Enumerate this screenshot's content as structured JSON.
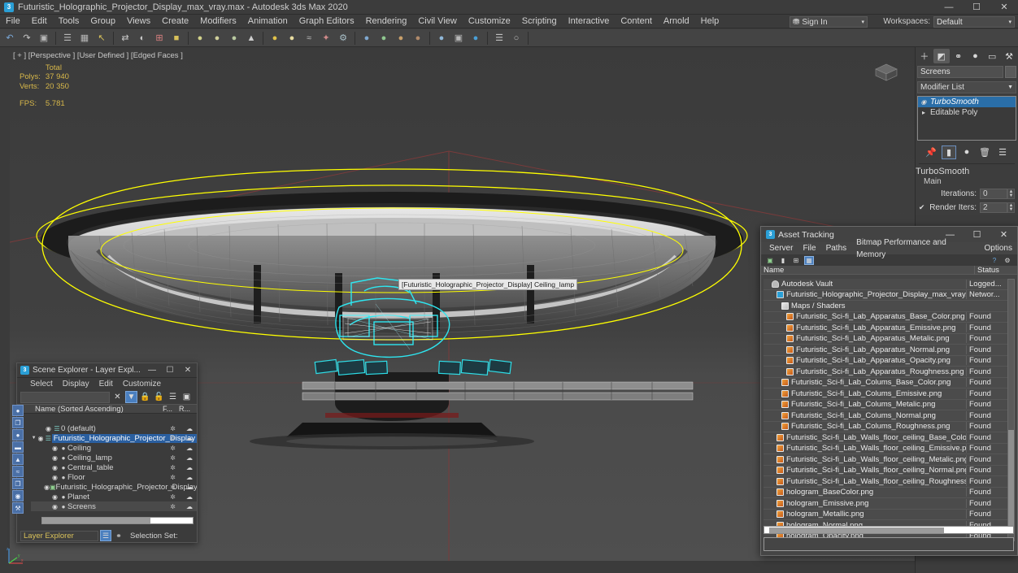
{
  "window": {
    "title": "Futuristic_Holographic_Projector_Display_max_vray.max - Autodesk 3ds Max 2020",
    "app_icon": "3",
    "minimize": "—",
    "maximize": "☐",
    "close": "✕"
  },
  "menubar": {
    "items": [
      "File",
      "Edit",
      "Tools",
      "Group",
      "Views",
      "Create",
      "Modifiers",
      "Animation",
      "Graph Editors",
      "Rendering",
      "Civil View",
      "Customize",
      "Scripting",
      "Interactive",
      "Content",
      "Arnold",
      "Help"
    ],
    "sign_in": "Sign In",
    "workspaces_label": "Workspaces:",
    "workspace_value": "Default",
    "caret": "▾",
    "person_icon": "⛃"
  },
  "toolbar": {
    "buttons": [
      {
        "name": "undo-icon",
        "glyph": "↶",
        "color": "#7aa8d8"
      },
      {
        "name": "redo-icon",
        "glyph": "↷",
        "color": "#c9c9c9"
      },
      {
        "name": "select-link-icon",
        "glyph": "▣",
        "color": "#b7b7b7"
      },
      {
        "name": "unlink-icon",
        "glyph": "☰",
        "color": "#b7b7b7"
      },
      {
        "name": "bind-space-warp-icon",
        "glyph": "▦",
        "color": "#b7b7b7"
      },
      {
        "name": "select-object-icon",
        "glyph": "↖",
        "color": "#d8c15a"
      },
      {
        "name": "select-by-name-icon",
        "glyph": "⇄",
        "color": "#c9c9c9"
      },
      {
        "name": "select-region-icon",
        "glyph": "◐",
        "color": "#c9c9c9"
      },
      {
        "name": "window-crossing-icon",
        "glyph": "⊞",
        "color": "#d98080"
      },
      {
        "name": "select-move-icon",
        "glyph": "■",
        "color": "#d8c15a"
      },
      {
        "name": "select-rotate-icon",
        "glyph": "●",
        "color": "#d2d28a"
      },
      {
        "name": "select-scale-icon",
        "glyph": "●",
        "color": "#cfcf9a"
      },
      {
        "name": "placement-icon",
        "glyph": "●",
        "color": "#b9c9a0"
      },
      {
        "name": "reference-coord-icon",
        "glyph": "▲",
        "color": "#cfcfcf"
      },
      {
        "name": "pivot-point-icon",
        "glyph": "●",
        "color": "#e0c24a"
      },
      {
        "name": "snap-toggle-icon",
        "glyph": "●",
        "color": "#e8dca0"
      },
      {
        "name": "angle-snap-icon",
        "glyph": "≈",
        "color": "#bcbcbc"
      },
      {
        "name": "percent-snap-icon",
        "glyph": "✦",
        "color": "#d08a8a"
      },
      {
        "name": "spinner-snap-icon",
        "glyph": "⚙",
        "color": "#a9c0c9"
      },
      {
        "name": "mirror-icon",
        "glyph": "●",
        "color": "#7fa8d0"
      },
      {
        "name": "align-icon",
        "glyph": "●",
        "color": "#8fc78f"
      },
      {
        "name": "layer-explorer-icon",
        "glyph": "●",
        "color": "#c9a06a"
      },
      {
        "name": "ribbon-icon",
        "glyph": "●",
        "color": "#b08a6a"
      },
      {
        "name": "curve-editor-icon",
        "glyph": "●",
        "color": "#8fb7d8"
      },
      {
        "name": "schematic-view-icon",
        "glyph": "▣",
        "color": "#b8b8b8"
      },
      {
        "name": "material-editor-icon",
        "glyph": "●",
        "color": "#4a9fd6"
      },
      {
        "name": "render-setup-icon",
        "glyph": "☰",
        "color": "#c0c0c0"
      },
      {
        "name": "render-frame-icon",
        "glyph": "○",
        "color": "#bdbdbd"
      }
    ]
  },
  "viewport": {
    "header": "[ + ] [Perspective ] [User Defined ] [Edged Faces ]",
    "stats": {
      "total_label": "Total",
      "polys_label": "Polys:",
      "polys_value": "37 940",
      "verts_label": "Verts:",
      "verts_value": "20 350",
      "fps_label": "FPS:",
      "fps_value": "5.781"
    },
    "object_label": "[Futuristic_Holographic_Projector_Display] Ceiling_lamp",
    "selection_color": "#ffff00",
    "sub_selection_color": "#2ee6f0"
  },
  "left_toolbar": {
    "items": [
      {
        "name": "select-object-tool",
        "glyph": "●"
      },
      {
        "name": "select-similar-tool",
        "glyph": "❐"
      },
      {
        "name": "light-tool",
        "glyph": "●"
      },
      {
        "name": "camera-tool",
        "glyph": "▬"
      },
      {
        "name": "cone-tool",
        "glyph": "▲"
      },
      {
        "name": "wave-tool",
        "glyph": "≈"
      },
      {
        "name": "clone-tool",
        "glyph": "❐"
      },
      {
        "name": "globe-tool",
        "glyph": "◉"
      },
      {
        "name": "wrench-tool",
        "glyph": "⚒"
      }
    ]
  },
  "command_panel": {
    "tabs": [
      {
        "name": "create-tab",
        "glyph": "＋",
        "active": false
      },
      {
        "name": "modify-tab",
        "glyph": "◩",
        "active": true
      },
      {
        "name": "hierarchy-tab",
        "glyph": "⚭",
        "active": false
      },
      {
        "name": "motion-tab",
        "glyph": "●",
        "active": false
      },
      {
        "name": "display-tab",
        "glyph": "▭",
        "active": false
      },
      {
        "name": "utilities-tab",
        "glyph": "⚒",
        "active": false
      }
    ],
    "object_name": "Screens",
    "modifier_list_label": "Modifier List",
    "stack": [
      {
        "label": "TurboSmooth",
        "selected": true
      },
      {
        "label": "Editable Poly",
        "selected": false
      }
    ],
    "stack_buttons": [
      {
        "name": "pin-stack-icon",
        "glyph": "📌",
        "active": false
      },
      {
        "name": "show-end-result-icon",
        "glyph": "▮",
        "active": true
      },
      {
        "name": "make-unique-icon",
        "glyph": "●",
        "active": false
      },
      {
        "name": "remove-modifier-icon",
        "glyph": "🗑",
        "active": false
      },
      {
        "name": "configure-modifier-sets-icon",
        "glyph": "☰",
        "active": false
      }
    ],
    "rollout": {
      "title": "TurboSmooth",
      "section": "Main",
      "iterations_label": "Iterations:",
      "iterations_value": "0",
      "render_iters_label": "Render Iters:",
      "render_iters_value": "2",
      "render_iters_checked": true
    }
  },
  "scene_explorer": {
    "title": "Scene Explorer - Layer Expl...",
    "app_icon": "3",
    "menu": [
      "Select",
      "Display",
      "Edit",
      "Customize"
    ],
    "tools": [
      {
        "name": "clear-search-icon",
        "glyph": "✕",
        "active": false
      },
      {
        "name": "filter-icon",
        "glyph": "▼",
        "active": true
      },
      {
        "name": "lock-icon",
        "glyph": "🔒",
        "active": false
      },
      {
        "name": "add-lock-icon",
        "glyph": "🔓",
        "active": false
      },
      {
        "name": "layers-icon",
        "glyph": "☰",
        "active": false
      },
      {
        "name": "new-layer-icon",
        "glyph": "▣",
        "active": false
      }
    ],
    "columns": {
      "name": "Name (Sorted Ascending)",
      "col2": "F...",
      "col3": "R..."
    },
    "rows": [
      {
        "label": "0 (default)",
        "indent": 1,
        "icon": "layers",
        "expandable": false,
        "selected": false,
        "highlight": false
      },
      {
        "label": "Futuristic_Holographic_Projector_Display",
        "indent": 0,
        "icon": "layer",
        "expandable": true,
        "selected": false,
        "highlight": true
      },
      {
        "label": "Ceiling",
        "indent": 2,
        "icon": "object",
        "expandable": false,
        "selected": false,
        "highlight": false
      },
      {
        "label": "Ceiling_lamp",
        "indent": 2,
        "icon": "object",
        "expandable": false,
        "selected": false,
        "highlight": false
      },
      {
        "label": "Central_table",
        "indent": 2,
        "icon": "object",
        "expandable": false,
        "selected": false,
        "highlight": false
      },
      {
        "label": "Floor",
        "indent": 2,
        "icon": "object",
        "expandable": false,
        "selected": false,
        "highlight": false
      },
      {
        "label": "Futuristic_Holographic_Projector_Display",
        "indent": 2,
        "icon": "group",
        "expandable": false,
        "selected": false,
        "highlight": false
      },
      {
        "label": "Planet",
        "indent": 2,
        "icon": "object",
        "expandable": false,
        "selected": false,
        "highlight": false
      },
      {
        "label": "Screens",
        "indent": 2,
        "icon": "object",
        "expandable": false,
        "selected": true,
        "highlight": false
      }
    ],
    "footer": {
      "layer_explorer": "Layer Explorer",
      "selection_set_label": "Selection Set:",
      "buttons": [
        {
          "name": "layer-mode-icon",
          "glyph": "☰",
          "active": true
        },
        {
          "name": "hierarchy-mode-icon",
          "glyph": "⚭",
          "active": false
        }
      ]
    }
  },
  "asset_tracking": {
    "title": "Asset Tracking",
    "app_icon": "3",
    "minimize": "—",
    "maximize": "☐",
    "close": "✕",
    "menu": [
      "Server",
      "File",
      "Paths",
      "Bitmap Performance and Memory",
      "Options"
    ],
    "toolbar": [
      {
        "name": "refresh-icon",
        "glyph": "▣",
        "active": false
      },
      {
        "name": "list-view-icon",
        "glyph": "▮",
        "active": false
      },
      {
        "name": "expand-icon",
        "glyph": "⊞",
        "active": false
      },
      {
        "name": "grid-view-icon",
        "glyph": "▦",
        "active": true
      },
      {
        "name": "help-icon",
        "glyph": "?",
        "active": false
      },
      {
        "name": "settings-icon",
        "glyph": "⚙",
        "active": false
      }
    ],
    "columns": {
      "name": "Name",
      "status": "Status"
    },
    "rows": [
      {
        "name": "Autodesk Vault",
        "status": "Logged...",
        "indent": 1,
        "icon": "vault"
      },
      {
        "name": "Futuristic_Holographic_Projector_Display_max_vray.max",
        "status": "Networ...",
        "indent": 2,
        "icon": "max"
      },
      {
        "name": "Maps / Shaders",
        "status": "",
        "indent": 3,
        "icon": "folder"
      },
      {
        "name": "Futuristic_Sci-fi_Lab_Apparatus_Base_Color.png",
        "status": "Found",
        "indent": 4,
        "icon": "png"
      },
      {
        "name": "Futuristic_Sci-fi_Lab_Apparatus_Emissive.png",
        "status": "Found",
        "indent": 4,
        "icon": "png"
      },
      {
        "name": "Futuristic_Sci-fi_Lab_Apparatus_Metalic.png",
        "status": "Found",
        "indent": 4,
        "icon": "png"
      },
      {
        "name": "Futuristic_Sci-fi_Lab_Apparatus_Normal.png",
        "status": "Found",
        "indent": 4,
        "icon": "png"
      },
      {
        "name": "Futuristic_Sci-fi_Lab_Apparatus_Opacity.png",
        "status": "Found",
        "indent": 4,
        "icon": "png"
      },
      {
        "name": "Futuristic_Sci-fi_Lab_Apparatus_Roughness.png",
        "status": "Found",
        "indent": 4,
        "icon": "png"
      },
      {
        "name": "Futuristic_Sci-fi_Lab_Colums_Base_Color.png",
        "status": "Found",
        "indent": 3,
        "icon": "png"
      },
      {
        "name": "Futuristic_Sci-fi_Lab_Colums_Emissive.png",
        "status": "Found",
        "indent": 3,
        "icon": "png"
      },
      {
        "name": "Futuristic_Sci-fi_Lab_Colums_Metalic.png",
        "status": "Found",
        "indent": 3,
        "icon": "png"
      },
      {
        "name": "Futuristic_Sci-fi_Lab_Colums_Normal.png",
        "status": "Found",
        "indent": 3,
        "icon": "png"
      },
      {
        "name": "Futuristic_Sci-fi_Lab_Colums_Roughness.png",
        "status": "Found",
        "indent": 3,
        "icon": "png"
      },
      {
        "name": "Futuristic_Sci-fi_Lab_Walls_floor_ceiling_Base_Color.png",
        "status": "Found",
        "indent": 2,
        "icon": "png"
      },
      {
        "name": "Futuristic_Sci-fi_Lab_Walls_floor_ceiling_Emissive.png",
        "status": "Found",
        "indent": 2,
        "icon": "png"
      },
      {
        "name": "Futuristic_Sci-fi_Lab_Walls_floor_ceiling_Metalic.png",
        "status": "Found",
        "indent": 2,
        "icon": "png"
      },
      {
        "name": "Futuristic_Sci-fi_Lab_Walls_floor_ceiling_Normal.png",
        "status": "Found",
        "indent": 2,
        "icon": "png"
      },
      {
        "name": "Futuristic_Sci-fi_Lab_Walls_floor_ceiling_Roughness.png",
        "status": "Found",
        "indent": 2,
        "icon": "png"
      },
      {
        "name": "hologram_BaseColor.png",
        "status": "Found",
        "indent": 2,
        "icon": "png"
      },
      {
        "name": "hologram_Emissive.png",
        "status": "Found",
        "indent": 2,
        "icon": "png"
      },
      {
        "name": "hologram_Metallic.png",
        "status": "Found",
        "indent": 2,
        "icon": "png"
      },
      {
        "name": "hologram_Normal.png",
        "status": "Found",
        "indent": 2,
        "icon": "png"
      },
      {
        "name": "hologram_Opacity.png",
        "status": "Found",
        "indent": 2,
        "icon": "png"
      }
    ]
  }
}
